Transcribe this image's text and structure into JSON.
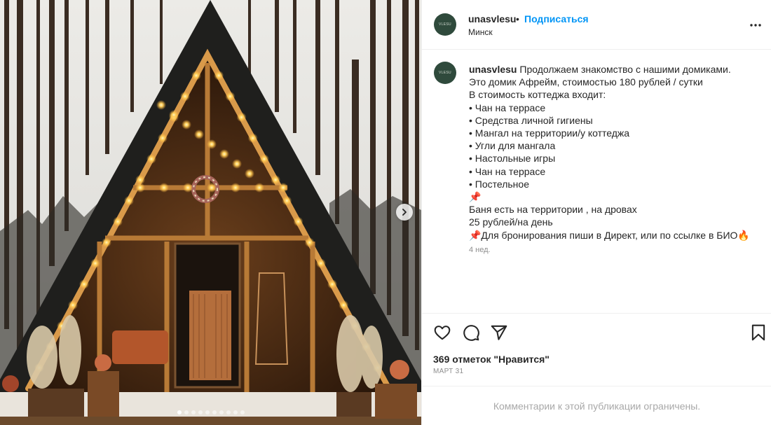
{
  "post": {
    "username": "unasvlesu",
    "avatar_text": "VLESU",
    "separator": "•",
    "follow_label": "Подписаться",
    "location": "Минск",
    "caption_lines": [
      "Продолжаем знакомство с нашими домиками.",
      "Это домик Афрейм, стоимостью 180 рублей / сутки",
      "В стоимость коттеджа входит:",
      "• Чан на террасе",
      "• Средства личной гигиены",
      "• Мангал на территории/у коттеджа",
      "• Угли для мангала",
      "• Настольные игры",
      "• Чан на террасе",
      "• Постельное",
      "📌",
      "Баня есть на территории , на дровах",
      "25 рублей/на день",
      "📌Для бронирования пиши в Директ, или по ссылке в БИО🔥"
    ],
    "caption_age": "4 нед.",
    "likes_text": "369 отметок \"Нравится\"",
    "date_text": "МАРТ 31",
    "comments_notice": "Комментарии к этой публикации ограничены."
  },
  "media": {
    "carousel": {
      "total_slides": 10,
      "current_slide": 1
    }
  },
  "colors": {
    "link": "#0095f6",
    "muted": "#8e8e8e",
    "text": "#262626",
    "avatar_bg": "#2f4a3c"
  },
  "icons": {
    "more": "more-options-icon",
    "like": "heart-icon",
    "comment": "comment-icon",
    "share": "share-icon",
    "save": "bookmark-icon",
    "next": "chevron-right-icon"
  }
}
